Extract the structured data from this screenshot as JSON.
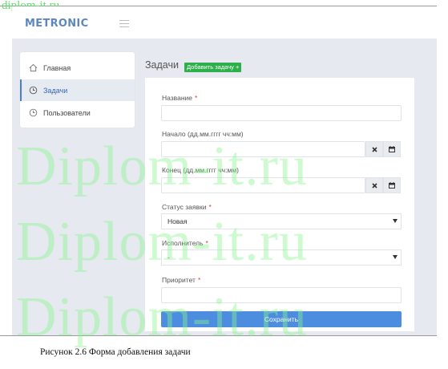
{
  "watermark": {
    "top_text": "diplom-it.ru",
    "big_text": "Diplom-it.ru"
  },
  "header": {
    "brand": "METRONIC",
    "menu_icon": "hamburger-icon"
  },
  "sidebar": {
    "items": [
      {
        "label": "Главная",
        "icon": "home-icon",
        "active": false
      },
      {
        "label": "Задачи",
        "icon": "clock-icon",
        "active": true
      },
      {
        "label": "Пользователи",
        "icon": "clock-icon",
        "active": false
      }
    ]
  },
  "page": {
    "title": "Задачи",
    "add_button": "Добавить задачу +"
  },
  "form": {
    "name_label": "Название",
    "name_value": "",
    "start_label": "Начало (дд.мм.гггг чч:мм)",
    "start_value": "",
    "end_label": "Конец (дд.мм.гггг чч:мм)",
    "end_value": "",
    "status_label": "Статус заявки",
    "status_value": "Новая",
    "assignee_label": "Исполнитель",
    "assignee_value": "-",
    "priority_label": "Приоритет",
    "priority_value": "",
    "required_mark": "*",
    "save_button": "Сохранить"
  },
  "caption": "Рисунок 2.6 Форма добавления задачи",
  "colors": {
    "brand": "#5e88bd",
    "accent": "#4d8de0",
    "add_button": "#2fae4c",
    "required": "#e23b3b",
    "background": "#e6e9ef"
  }
}
